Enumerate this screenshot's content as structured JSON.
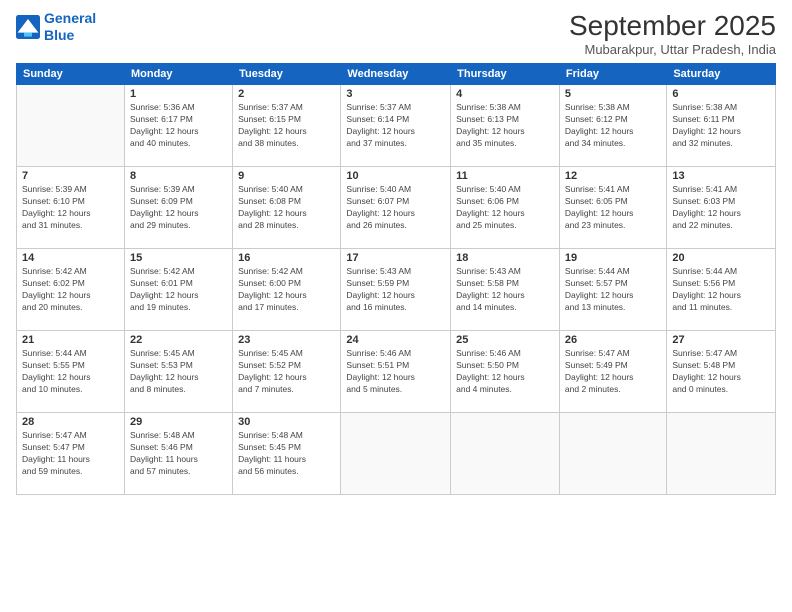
{
  "logo": {
    "line1": "General",
    "line2": "Blue"
  },
  "title": "September 2025",
  "subtitle": "Mubarakpur, Uttar Pradesh, India",
  "weekdays": [
    "Sunday",
    "Monday",
    "Tuesday",
    "Wednesday",
    "Thursday",
    "Friday",
    "Saturday"
  ],
  "weeks": [
    [
      {
        "day": "",
        "info": ""
      },
      {
        "day": "1",
        "info": "Sunrise: 5:36 AM\nSunset: 6:17 PM\nDaylight: 12 hours\nand 40 minutes."
      },
      {
        "day": "2",
        "info": "Sunrise: 5:37 AM\nSunset: 6:15 PM\nDaylight: 12 hours\nand 38 minutes."
      },
      {
        "day": "3",
        "info": "Sunrise: 5:37 AM\nSunset: 6:14 PM\nDaylight: 12 hours\nand 37 minutes."
      },
      {
        "day": "4",
        "info": "Sunrise: 5:38 AM\nSunset: 6:13 PM\nDaylight: 12 hours\nand 35 minutes."
      },
      {
        "day": "5",
        "info": "Sunrise: 5:38 AM\nSunset: 6:12 PM\nDaylight: 12 hours\nand 34 minutes."
      },
      {
        "day": "6",
        "info": "Sunrise: 5:38 AM\nSunset: 6:11 PM\nDaylight: 12 hours\nand 32 minutes."
      }
    ],
    [
      {
        "day": "7",
        "info": "Sunrise: 5:39 AM\nSunset: 6:10 PM\nDaylight: 12 hours\nand 31 minutes."
      },
      {
        "day": "8",
        "info": "Sunrise: 5:39 AM\nSunset: 6:09 PM\nDaylight: 12 hours\nand 29 minutes."
      },
      {
        "day": "9",
        "info": "Sunrise: 5:40 AM\nSunset: 6:08 PM\nDaylight: 12 hours\nand 28 minutes."
      },
      {
        "day": "10",
        "info": "Sunrise: 5:40 AM\nSunset: 6:07 PM\nDaylight: 12 hours\nand 26 minutes."
      },
      {
        "day": "11",
        "info": "Sunrise: 5:40 AM\nSunset: 6:06 PM\nDaylight: 12 hours\nand 25 minutes."
      },
      {
        "day": "12",
        "info": "Sunrise: 5:41 AM\nSunset: 6:05 PM\nDaylight: 12 hours\nand 23 minutes."
      },
      {
        "day": "13",
        "info": "Sunrise: 5:41 AM\nSunset: 6:03 PM\nDaylight: 12 hours\nand 22 minutes."
      }
    ],
    [
      {
        "day": "14",
        "info": "Sunrise: 5:42 AM\nSunset: 6:02 PM\nDaylight: 12 hours\nand 20 minutes."
      },
      {
        "day": "15",
        "info": "Sunrise: 5:42 AM\nSunset: 6:01 PM\nDaylight: 12 hours\nand 19 minutes."
      },
      {
        "day": "16",
        "info": "Sunrise: 5:42 AM\nSunset: 6:00 PM\nDaylight: 12 hours\nand 17 minutes."
      },
      {
        "day": "17",
        "info": "Sunrise: 5:43 AM\nSunset: 5:59 PM\nDaylight: 12 hours\nand 16 minutes."
      },
      {
        "day": "18",
        "info": "Sunrise: 5:43 AM\nSunset: 5:58 PM\nDaylight: 12 hours\nand 14 minutes."
      },
      {
        "day": "19",
        "info": "Sunrise: 5:44 AM\nSunset: 5:57 PM\nDaylight: 12 hours\nand 13 minutes."
      },
      {
        "day": "20",
        "info": "Sunrise: 5:44 AM\nSunset: 5:56 PM\nDaylight: 12 hours\nand 11 minutes."
      }
    ],
    [
      {
        "day": "21",
        "info": "Sunrise: 5:44 AM\nSunset: 5:55 PM\nDaylight: 12 hours\nand 10 minutes."
      },
      {
        "day": "22",
        "info": "Sunrise: 5:45 AM\nSunset: 5:53 PM\nDaylight: 12 hours\nand 8 minutes."
      },
      {
        "day": "23",
        "info": "Sunrise: 5:45 AM\nSunset: 5:52 PM\nDaylight: 12 hours\nand 7 minutes."
      },
      {
        "day": "24",
        "info": "Sunrise: 5:46 AM\nSunset: 5:51 PM\nDaylight: 12 hours\nand 5 minutes."
      },
      {
        "day": "25",
        "info": "Sunrise: 5:46 AM\nSunset: 5:50 PM\nDaylight: 12 hours\nand 4 minutes."
      },
      {
        "day": "26",
        "info": "Sunrise: 5:47 AM\nSunset: 5:49 PM\nDaylight: 12 hours\nand 2 minutes."
      },
      {
        "day": "27",
        "info": "Sunrise: 5:47 AM\nSunset: 5:48 PM\nDaylight: 12 hours\nand 0 minutes."
      }
    ],
    [
      {
        "day": "28",
        "info": "Sunrise: 5:47 AM\nSunset: 5:47 PM\nDaylight: 11 hours\nand 59 minutes."
      },
      {
        "day": "29",
        "info": "Sunrise: 5:48 AM\nSunset: 5:46 PM\nDaylight: 11 hours\nand 57 minutes."
      },
      {
        "day": "30",
        "info": "Sunrise: 5:48 AM\nSunset: 5:45 PM\nDaylight: 11 hours\nand 56 minutes."
      },
      {
        "day": "",
        "info": ""
      },
      {
        "day": "",
        "info": ""
      },
      {
        "day": "",
        "info": ""
      },
      {
        "day": "",
        "info": ""
      }
    ]
  ]
}
